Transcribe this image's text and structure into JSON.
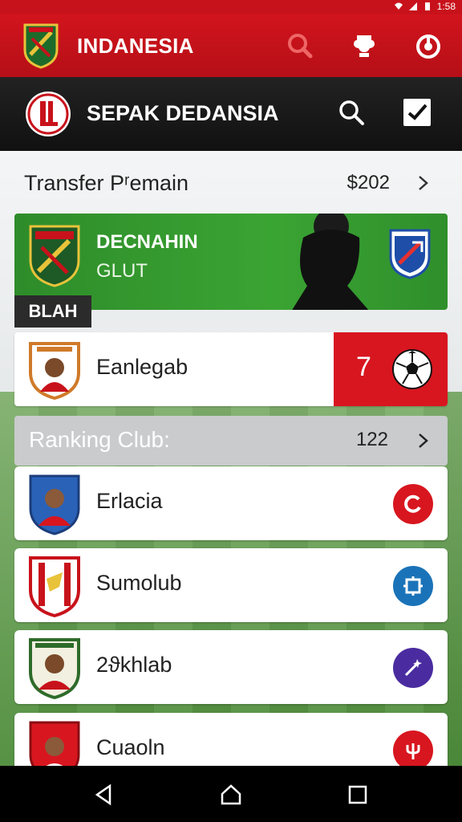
{
  "status_bar": {
    "time": "1:58"
  },
  "top_bar": {
    "title": "INDANESIA",
    "icons": [
      "search-icon",
      "trophy-icon",
      "power-icon"
    ]
  },
  "sub_bar": {
    "title": "SEPAK DEDANSIA",
    "icons": [
      "search-icon",
      "checkbox-icon"
    ]
  },
  "transfer": {
    "label": "Transfer Pʳemain",
    "value": "$202"
  },
  "featured_club": {
    "name": "DECNAHIN",
    "sub": "GLUT",
    "tag": "BLAH"
  },
  "player_card": {
    "name": "Eanlegab",
    "number": "7"
  },
  "ranking": {
    "label": "Ranking Club:",
    "value": "122"
  },
  "clubs": [
    {
      "name": "Erlacia",
      "circle_color": "#d8161f",
      "icon": "refresh-icon"
    },
    {
      "name": "Sumolub",
      "circle_color": "#1a73b8",
      "icon": "frame-icon"
    },
    {
      "name": "2ϑkhlab",
      "circle_color": "#4a2ca0",
      "icon": "wand-icon"
    },
    {
      "name": "Cuaoln",
      "circle_color": "#d8161f",
      "icon": "trident-icon"
    }
  ],
  "colors": {
    "brand_red": "#c8121b",
    "dark_bar": "#151515",
    "green_card": "#3aa433"
  }
}
